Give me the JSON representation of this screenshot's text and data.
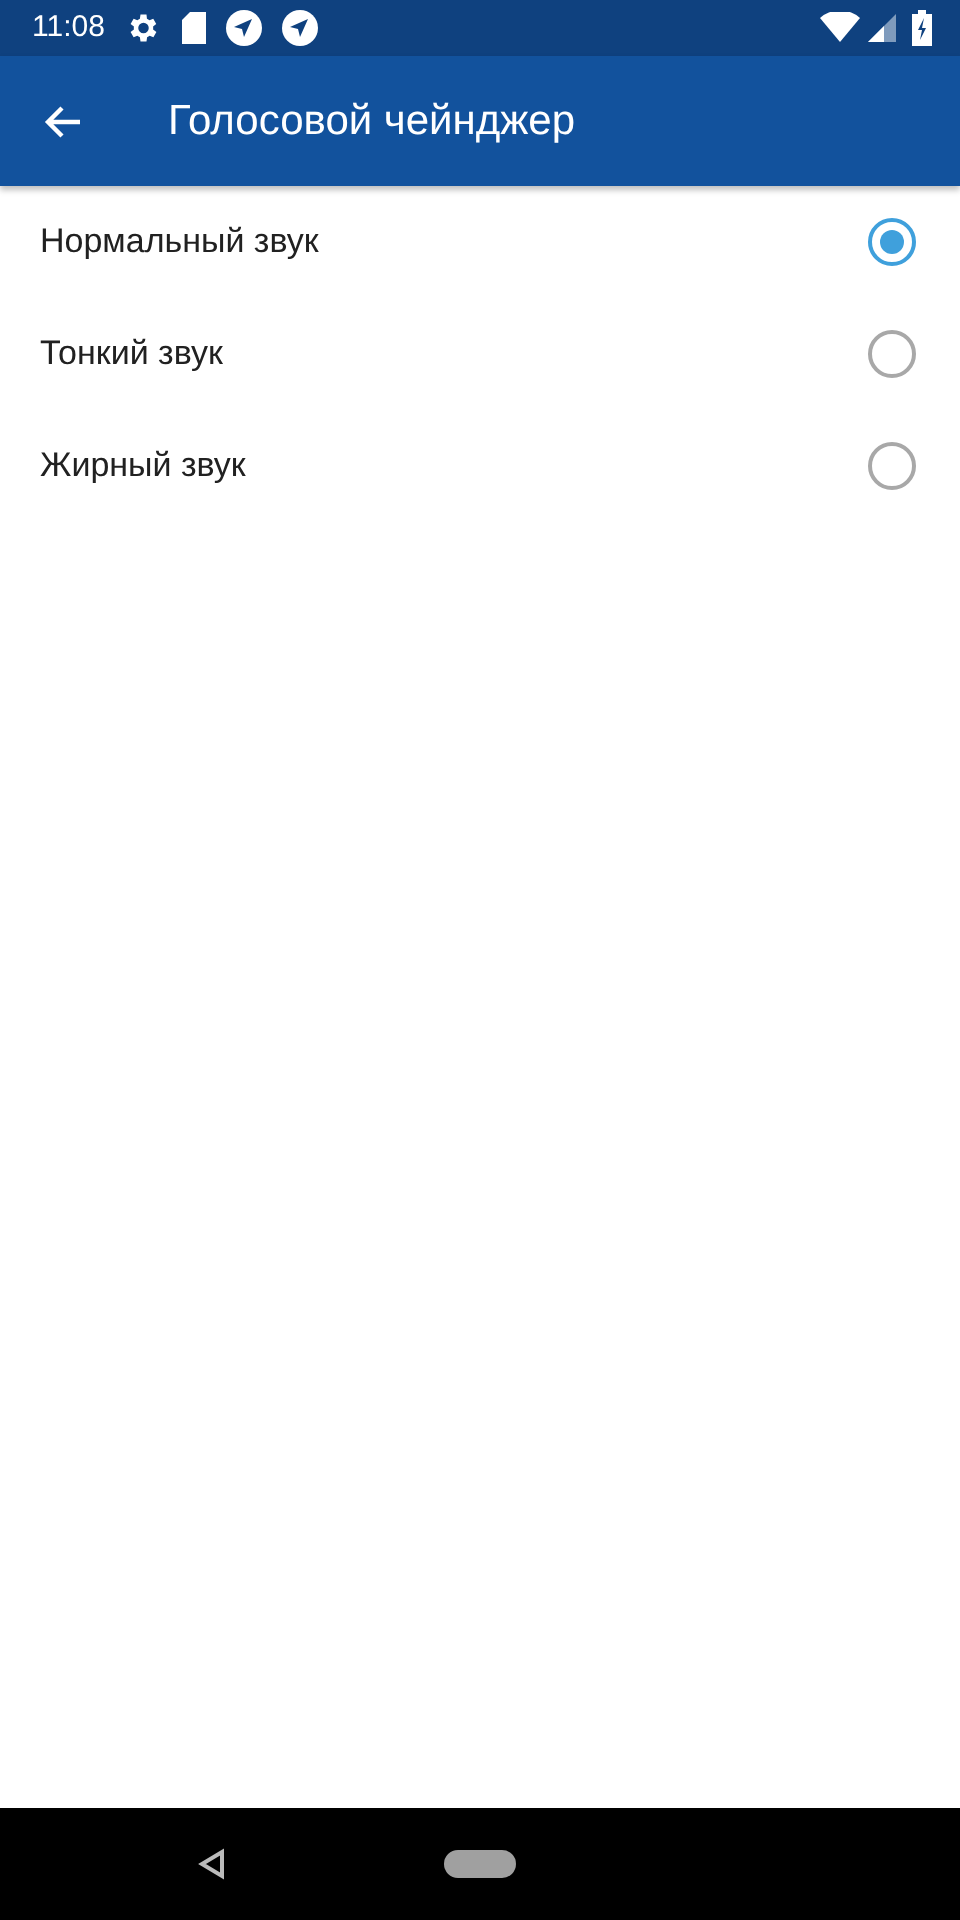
{
  "status_bar": {
    "time": "11:08"
  },
  "toolbar": {
    "title": "Голосовой чейнджер"
  },
  "options": [
    {
      "label": "Нормальный звук",
      "selected": true
    },
    {
      "label": "Тонкий звук",
      "selected": false
    },
    {
      "label": "Жирный звук",
      "selected": false
    }
  ]
}
